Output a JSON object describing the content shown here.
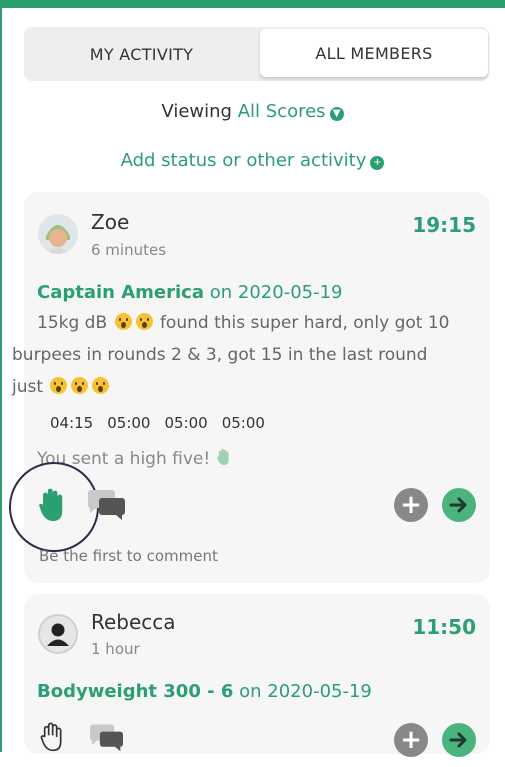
{
  "tabs": [
    {
      "label": "MY ACTIVITY",
      "active": false
    },
    {
      "label": "ALL MEMBERS",
      "active": true
    }
  ],
  "filter": {
    "prefix": "Viewing",
    "value": "All Scores",
    "icon": "chevron-down-circle-icon"
  },
  "add_status": {
    "label": "Add status or other activity",
    "icon": "plus-circle-icon"
  },
  "colors": {
    "accent": "#2c9f70",
    "card_bg": "#f6f6f6",
    "muted": "#888888"
  },
  "posts": [
    {
      "user": "Zoe",
      "time_ago": "6 minutes",
      "score": "19:15",
      "workout": "Captain America",
      "on_label": "on 2020-05-19",
      "note_lines": [
        "15kg dB",
        "found this super hard, only got 10",
        "burpees in rounds 2 & 3, got 15 in the last round",
        "just"
      ],
      "splits": [
        "04:15",
        "05:00",
        "05:00",
        "05:00"
      ],
      "high_five_text": "You sent a high five!",
      "comments_text": "Be the first to comment",
      "high_fived": true
    },
    {
      "user": "Rebecca",
      "time_ago": "1 hour",
      "score": "11:50",
      "workout": "Bodyweight 300 - 6",
      "on_label": "on 2020-05-19",
      "high_fived": false
    }
  ]
}
